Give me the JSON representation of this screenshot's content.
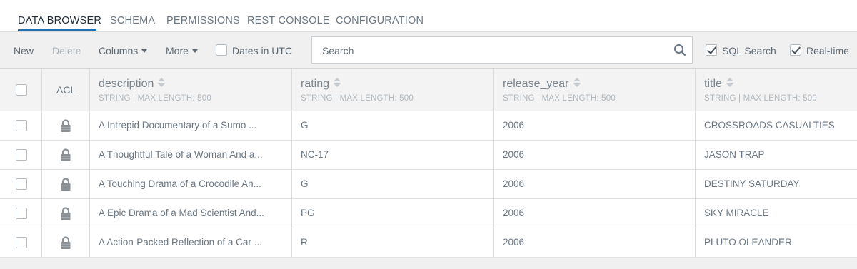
{
  "tabs": [
    {
      "label": "DATA BROWSER",
      "active": true
    },
    {
      "label": "SCHEMA",
      "active": false
    },
    {
      "label": "PERMISSIONS",
      "active": false
    },
    {
      "label": "REST CONSOLE",
      "active": false
    },
    {
      "label": "CONFIGURATION",
      "active": false
    }
  ],
  "toolbar": {
    "new_label": "New",
    "delete_label": "Delete",
    "columns_label": "Columns",
    "more_label": "More",
    "dates_utc_label": "Dates in UTC",
    "dates_utc_checked": false,
    "search_placeholder": "Search",
    "sql_search_label": "SQL Search",
    "sql_search_checked": true,
    "realtime_label": "Real-time",
    "realtime_checked": true
  },
  "table": {
    "acl_header": "ACL",
    "columns": [
      {
        "name": "description",
        "meta": "STRING | MAX LENGTH: 500"
      },
      {
        "name": "rating",
        "meta": "STRING | MAX LENGTH: 500"
      },
      {
        "name": "release_year",
        "meta": "STRING | MAX LENGTH: 500"
      },
      {
        "name": "title",
        "meta": "STRING | MAX LENGTH: 500"
      }
    ],
    "rows": [
      {
        "description": "A Intrepid Documentary of a Sumo ...",
        "rating": "G",
        "release_year": "2006",
        "title": "CROSSROADS CASUALTIES"
      },
      {
        "description": "A Thoughtful Tale of a Woman And a...",
        "rating": "NC-17",
        "release_year": "2006",
        "title": "JASON TRAP"
      },
      {
        "description": "A Touching Drama of a Crocodile An...",
        "rating": "G",
        "release_year": "2006",
        "title": "DESTINY SATURDAY"
      },
      {
        "description": "A Epic Drama of a Mad Scientist And...",
        "rating": "PG",
        "release_year": "2006",
        "title": "SKY MIRACLE"
      },
      {
        "description": "A Action-Packed Reflection of a Car ...",
        "rating": "R",
        "release_year": "2006",
        "title": "PLUTO OLEANDER"
      }
    ]
  },
  "icons": {
    "search": "search-icon",
    "acl": "lock-icon"
  },
  "colors": {
    "accent": "#1f6fb2",
    "background": "#f0f0f0",
    "text": "#6b7782"
  }
}
